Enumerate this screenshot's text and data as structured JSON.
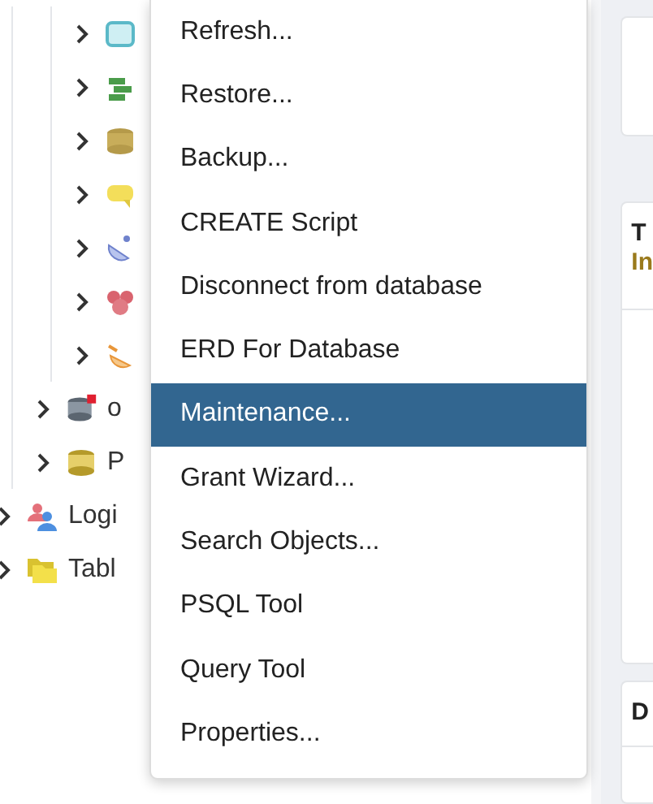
{
  "tree": [
    {
      "children": [
        {
          "children": [
            {
              "expanded": false
            },
            {
              "expanded": false
            },
            {
              "expanded": false
            },
            {
              "expanded": false
            },
            {
              "expanded": false
            },
            {
              "expanded": false
            },
            {
              "expanded": false
            }
          ]
        },
        {
          "label": "o",
          "expanded": false
        },
        {
          "label": "P",
          "expanded": false
        }
      ]
    },
    {
      "label": "Logi",
      "expanded": false
    },
    {
      "label": "Tabl",
      "expanded": false
    }
  ],
  "context_menu": {
    "items": [
      {
        "label": "Refresh...",
        "selected": false
      },
      {
        "label": "Restore...",
        "selected": false
      },
      {
        "label": "Backup...",
        "selected": false
      },
      {
        "label": "CREATE Script",
        "selected": false
      },
      {
        "label": "Disconnect from database",
        "selected": false
      },
      {
        "label": "ERD For Database",
        "selected": false
      },
      {
        "label": "Maintenance...",
        "selected": true
      },
      {
        "label": "Grant Wizard...",
        "selected": false
      },
      {
        "label": "Search Objects...",
        "selected": false
      },
      {
        "label": "PSQL Tool",
        "selected": false
      },
      {
        "label": "Query Tool",
        "selected": false
      },
      {
        "label": "Properties...",
        "selected": false
      }
    ]
  },
  "right_panel": {
    "card_title": "T",
    "card_subtitle": "In",
    "bottom_card_title": "D"
  }
}
